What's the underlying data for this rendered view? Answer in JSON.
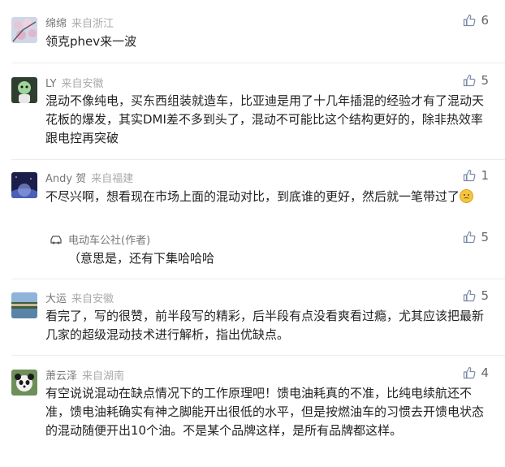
{
  "comments": [
    {
      "name": "绵绵",
      "from": "来自浙江",
      "likes": "6",
      "text": "领克phev来一波",
      "avatar": "cherry-blossom-avatar"
    },
    {
      "name": "LY",
      "from": "来自安徽",
      "likes": "5",
      "text": "混动不像纯电，买东西组装就造车，比亚迪是用了十几年插混的经验才有了混动天花板的爆发，其实DMI差不多到头了，混动不可能比这个结构更好的，除非热效率跟电控再突破",
      "avatar": "cartoon-character-avatar"
    },
    {
      "name": "Andy 贺",
      "from": "来自福建",
      "likes": "1",
      "text": "不尽兴啊，想看现在市场上面的混动对比，到底谁的更好，然后就一笔带过了",
      "avatar": "night-sky-avatar",
      "reply": {
        "name": "电动车公社(作者)",
        "likes": "5",
        "text": "（意思是，还有下集哈哈哈"
      }
    },
    {
      "name": "大运",
      "from": "来自安徽",
      "likes": "5",
      "text": "看完了，写的很赞，前半段写的精彩，后半段有点没看爽看过瘾，尤其应该把最新几家的超级混动技术进行解析，指出优缺点。",
      "avatar": "landscape-avatar"
    },
    {
      "name": "萧云泽",
      "from": "来自湖南",
      "likes": "4",
      "text": "有空说说混动在缺点情况下的工作原理吧！馈电油耗真的不准，比纯电续航还不准，馈电油耗确实有神之脚能开出很低的水平，但是按燃油车的习惯去开馈电状态的混动随便开出10个油。不是某个品牌这样，是所有品牌都这样。",
      "avatar": "panda-avatar"
    }
  ]
}
